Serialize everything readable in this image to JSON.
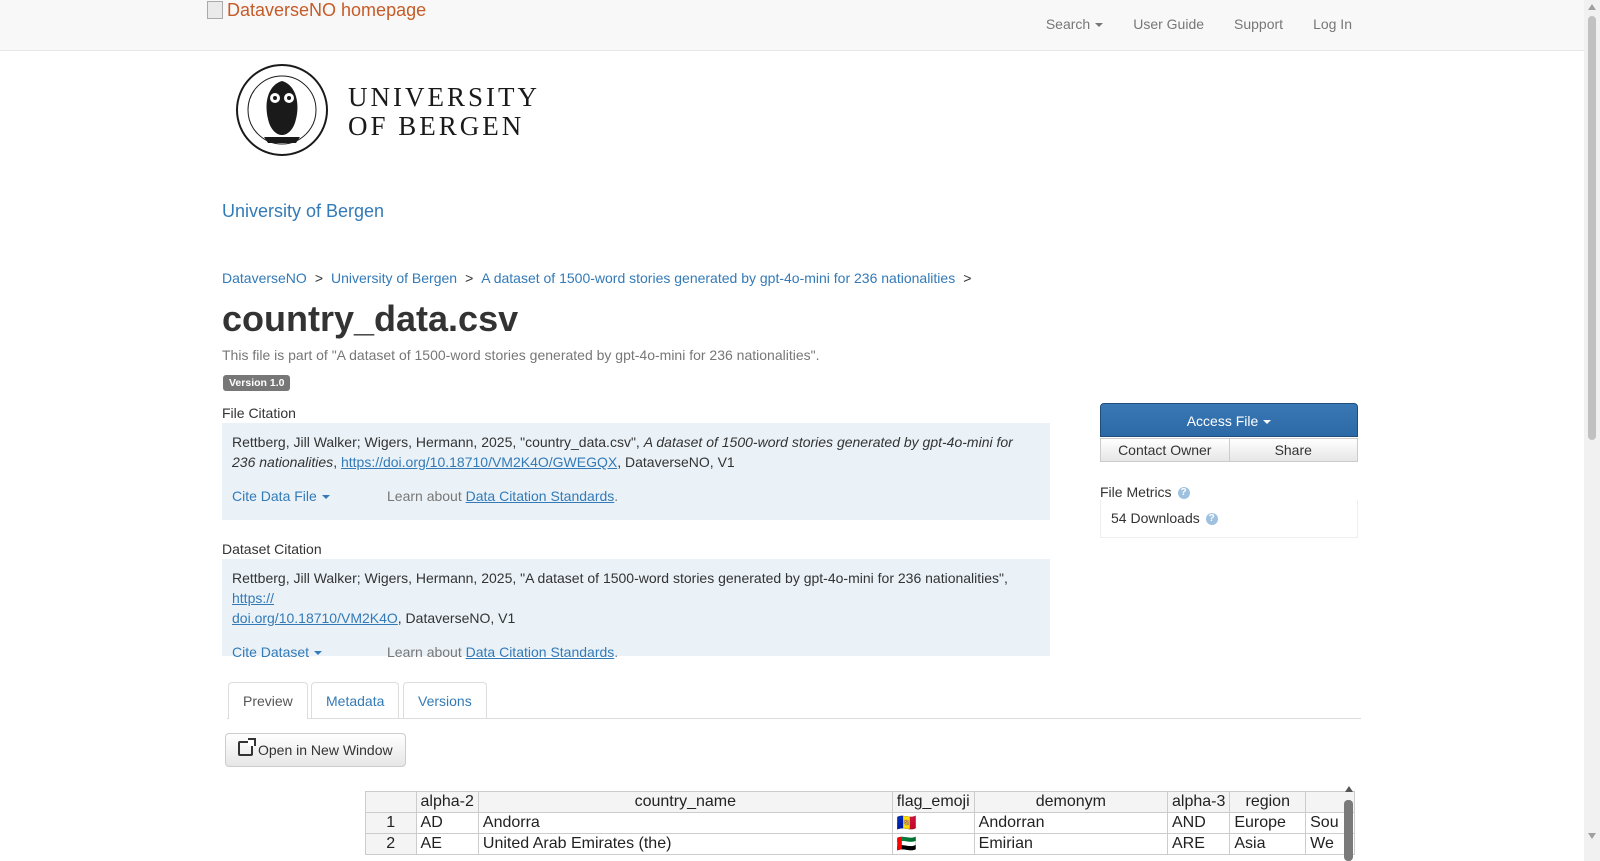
{
  "navbar": {
    "brand_alt": "DataverseNO homepage",
    "search_label": "Search",
    "user_guide": "User Guide",
    "support": "Support",
    "log_in": "Log In"
  },
  "logo": {
    "line1": "UNIVERSITY",
    "line2": "OF BERGEN"
  },
  "dataverse_name": "University of Bergen",
  "breadcrumb": [
    "DataverseNO",
    "University of Bergen",
    "A dataset of 1500-word stories generated by gpt-4o-mini for 236 nationalities"
  ],
  "breadcrumb_sep": ">",
  "file": {
    "title": "country_data.csv",
    "part_of": "This file is part of \"A dataset of 1500-word stories generated by gpt-4o-mini for 236 nationalities\".",
    "version": "Version 1.0"
  },
  "file_citation": {
    "label": "File Citation",
    "authors": "Rettberg, Jill Walker; Wigers, Hermann, 2025, \"country_data.csv\", ",
    "dataset_title": "A dataset of 1500-word stories generated by gpt-4o-mini for 236 nationalities",
    "doi": "https://doi.org/10.18710/VM2K4O/GWEGQX",
    "suffix": ", DataverseNO, V1",
    "cite_button": "Cite Data File",
    "learn_prefix": "Learn about ",
    "learn_link": "Data Citation Standards"
  },
  "dataset_citation": {
    "label": "Dataset Citation",
    "text": "Rettberg, Jill Walker; Wigers, Hermann, 2025, \"A dataset of 1500-word stories generated by gpt-4o-mini for 236 nationalities\", ",
    "doi_part1": "https://",
    "doi_part2": "doi.org/10.18710/VM2K4O",
    "suffix": ", DataverseNO, V1",
    "cite_button": "Cite Dataset",
    "learn_prefix": "Learn about ",
    "learn_link": "Data Citation Standards"
  },
  "actions": {
    "access_file": "Access File",
    "contact_owner": "Contact Owner",
    "share": "Share"
  },
  "metrics": {
    "title": "File Metrics",
    "downloads": "54 Downloads"
  },
  "tabs": [
    "Preview",
    "Metadata",
    "Versions"
  ],
  "open_new_window": "Open in New Window",
  "preview_table": {
    "headers": [
      "",
      "alpha-2",
      "country_name",
      "flag_emoji",
      "demonym",
      "alpha-3",
      "region",
      ""
    ],
    "rows": [
      [
        "1",
        "AD",
        "Andorra",
        "🇦🇩",
        "Andorran",
        "AND",
        "Europe",
        "Sou"
      ],
      [
        "2",
        "AE",
        "United Arab Emirates (the)",
        "🇦🇪",
        "Emirian",
        "ARE",
        "Asia",
        "We"
      ]
    ]
  }
}
